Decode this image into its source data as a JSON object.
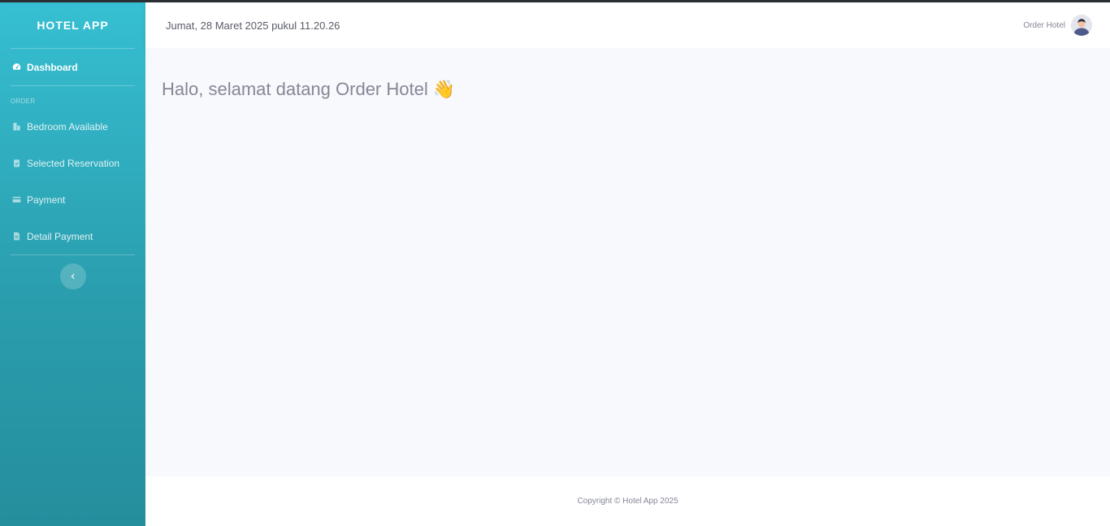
{
  "sidebar": {
    "brand": "HOTEL APP",
    "dashboard_label": "Dashboard",
    "section_heading": "ORDER",
    "items": [
      {
        "label": "Bedroom Available",
        "icon": "building-icon"
      },
      {
        "label": "Selected Reservation",
        "icon": "clipboard-check-icon"
      },
      {
        "label": "Payment",
        "icon": "credit-card-icon"
      },
      {
        "label": "Detail Payment",
        "icon": "file-invoice-icon"
      }
    ]
  },
  "topbar": {
    "datetime": "Jumat, 28 Maret 2025 pukul 11.20.26",
    "user_name": "Order Hotel"
  },
  "main": {
    "greeting": "Halo, selamat datang Order Hotel 👋"
  },
  "footer": {
    "copyright": "Copyright © Hotel App 2025"
  },
  "colors": {
    "sidebar_top": "#36bfd2",
    "sidebar_bottom": "#258e9d",
    "text_muted": "#858796"
  }
}
